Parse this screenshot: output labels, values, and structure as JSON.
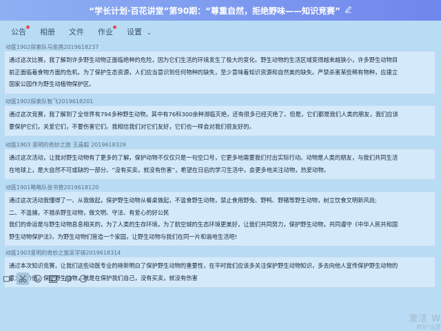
{
  "window": {
    "title": "“学长计划·百花讲堂”第90期：“尊重自然，拒绝野味——知识竞赛”",
    "edit_icon": "pencil-icon"
  },
  "tabs": [
    {
      "label": "公告",
      "has_badge": true
    },
    {
      "label": "相册",
      "has_badge": false
    },
    {
      "label": "文件",
      "has_badge": false
    },
    {
      "label": "作业",
      "has_badge": true
    },
    {
      "label": "设置",
      "has_chevron": true
    }
  ],
  "messages": [
    {
      "sender": "动医1902探索队马俊茜2019618237",
      "lines": [
        "通过这次比赛，我了解到许多野生动物正面临绝种的危险，因为它们生活的环境发生了极大的变化。野生动物的生活区域变得越来越狭小，许多野生动物目",
        "前正面临着食物方面的危机。为了保护生态资源，人们应当意识到任何物种的缺失，至少意味着知识资源和自然美的缺失。严禁杀害某些稀有物种，应建立",
        "国家公园作为野生动植物保护区。"
      ]
    },
    {
      "sender": "动医1902探索队智飞2019618201",
      "lines": [
        "通过这次竞赛，我了解到了全世界有794多种野生动物，其中有76科300余种濒临灭绝，还有很多已经灭绝了。但是，它们都是我们人类的朋友，我们应该",
        "要保护它们，关爱它们，不要伤害它们。我相信我们对它们友好，它们也一样会对我们很友好的。"
      ]
    },
    {
      "sender": "动医1903 意明的奇妙之旅 王晶毅 2019618329",
      "lines": [
        "通过这次活动，让我对野生动物有了更多的了解，保护动物不仅仅只是一句空口号，它更多地需要我们付出实际行动。动物是人类的朋友，与我们共同生活",
        "在地球上，是大自然不可或缺的一部分。“没有买卖，就没有伤害”，希望在日后的学习生活中，会更多地关注动物，热爱动物。"
      ]
    },
    {
      "sender": "动医1901略略队张书营2019618120",
      "lines": [
        "通过这次活动我懂得了一、从我做起，保护野生动物从餐桌做起，不滥食野生动物，禁止食用野兔、野鸭、野猪等野生动物，树立饮食文明新风尚;",
        "二、不滥捕，不猎杀野生动物，做文明、守法、有爱心的好公民",
        "我们的命运是与野生动物息息相关的，为了人类的生存环境，为了航空城的生态环境更美好，让我们共同努力，保护野生动物，共同遵守《中华人民共和国",
        "野生动物保护法》。为野生动物们营造一个家园，让野生动物与我们在同一片和谐地生活吧!"
      ]
    },
    {
      "sender": "动医1903意明的奇妙之旅吴学瑛2019618314",
      "lines": [
        "通过本次知识竞赛，让我们这些动医专业的晓新明白了保护野生动物的重要性，在平时我们应该多关注保护野生动物知识，多去向他人宣传保护野生动物的",
        "意义与价值，保护野生动物，就是在保护我们自己，没有买卖，就没有伤害"
      ]
    }
  ],
  "toolbar": {
    "icons": [
      "video-icon",
      "scissors-icon",
      "emoji-icon",
      "image-icon",
      "bell-icon",
      "more-icon"
    ]
  },
  "watermark": {
    "line1": "激活 W",
    "line2": "转到\"设置"
  }
}
